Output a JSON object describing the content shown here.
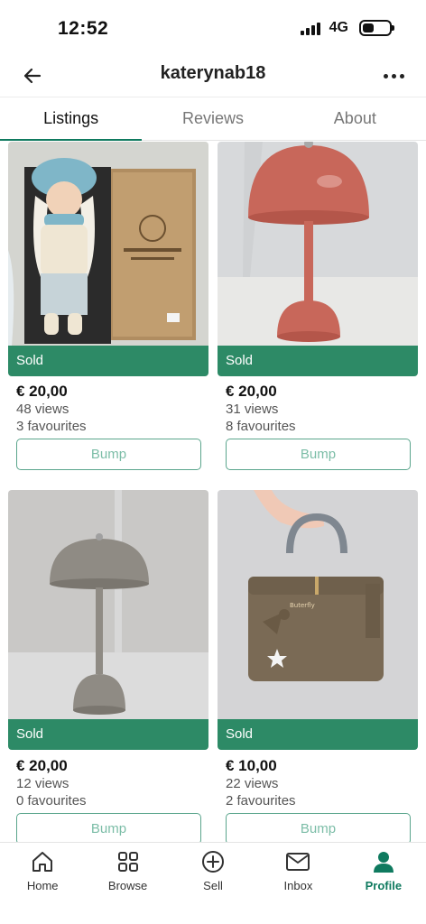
{
  "status_bar": {
    "time": "12:52",
    "network": "4G"
  },
  "header": {
    "title": "katerynab18"
  },
  "tabs": [
    {
      "label": "Listings",
      "active": true
    },
    {
      "label": "Reviews",
      "active": false
    },
    {
      "label": "About",
      "active": false
    }
  ],
  "listings": [
    {
      "status": "Sold",
      "price": "€ 20,00",
      "views": "48 views",
      "favourites": "3 favourites",
      "bump_label": "Bump",
      "image": "doll-in-box"
    },
    {
      "status": "Sold",
      "price": "€ 20,00",
      "views": "31 views",
      "favourites": "8 favourites",
      "bump_label": "Bump",
      "image": "pink-mushroom-lamp"
    },
    {
      "status": "Sold",
      "price": "€ 20,00",
      "views": "12 views",
      "favourites": "0 favourites",
      "bump_label": "Bump",
      "image": "grey-mushroom-lamp"
    },
    {
      "status": "Sold",
      "price": "€ 10,00",
      "views": "22 views",
      "favourites": "2 favourites",
      "bump_label": "Bump",
      "image": "brown-handbag"
    }
  ],
  "bottom_nav": [
    {
      "label": "Home",
      "icon": "home-icon",
      "active": false
    },
    {
      "label": "Browse",
      "icon": "browse-icon",
      "active": false
    },
    {
      "label": "Sell",
      "icon": "sell-icon",
      "active": false
    },
    {
      "label": "Inbox",
      "icon": "inbox-icon",
      "active": false
    },
    {
      "label": "Profile",
      "icon": "profile-icon",
      "active": true
    }
  ],
  "colors": {
    "accent": "#0f7a5f",
    "sold_banner": "#2d8a66",
    "bump_text": "#7cbda7"
  }
}
